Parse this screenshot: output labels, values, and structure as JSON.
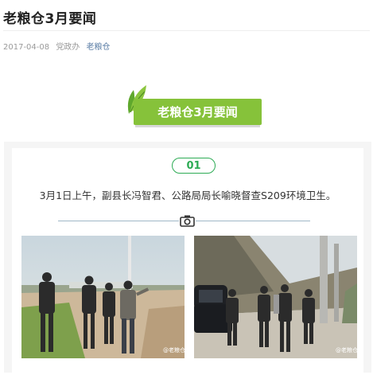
{
  "article": {
    "title": "老粮仓3月要闻",
    "date": "2017-04-08",
    "author": "党政办",
    "account": "老粮仓"
  },
  "banner": {
    "text": "老粮仓3月要闻"
  },
  "item": {
    "number": "01",
    "caption": "3月1日上午，副县长冯智君、公路局局长喻晓督查S209环境卫生。"
  },
  "colors": {
    "accent_green": "#86c23a",
    "badge_green": "#2dab55",
    "link_blue": "#5b7ea6"
  },
  "icons": [
    "leaf-icon",
    "camera-icon"
  ]
}
